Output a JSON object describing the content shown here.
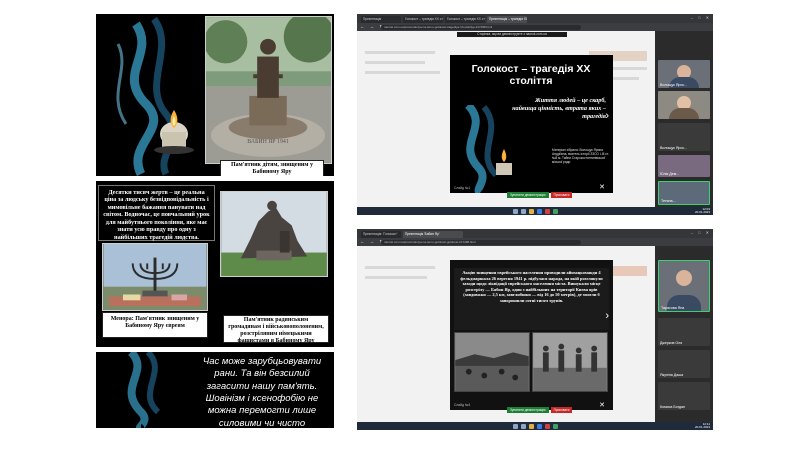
{
  "left_column": {
    "slide1": {
      "caption": "Пам'ятник дітям, знищеним у Бабиному Яру",
      "plinth_text": "ВАБИН ЯР 1941"
    },
    "slide2": {
      "text_block": "Десятки тисяч жертв – це реальна ціна за людську безвідповідальність і мимовільне бажання панувати над світом. Водночас, це повчальний урок для майбутнього покоління, яке має знати усю правду про одну з найбільших трагедій людства.",
      "menorah_caption": "Менора: Пам'ятник знищеним у Бабиному Яру євреям",
      "monument_caption": "Пам'ятник радянським громадянам і військовополоненим, розстріляним німецькими фашистами в Бабиному Яру"
    },
    "slide3": {
      "quote": "Час може зарубцьовувати рани. Та він безсилий загасити нашу пам'ять. Шовінізм і ксенофобію не можна перемогти лише силовими чи чисто політичними методами. Боротьба з цим злом проходить"
    }
  },
  "screenshot1": {
    "tabs": [
      "Презентація",
      "Голокост – трагедія ХХ столітт",
      "Голокост – трагедія ХХ ст",
      "Презентація – трагедія XX ст"
    ],
    "url": "naurok.com.ua/prezentaciya-na-temu-golokost-tragediya-hh-stolittya-217498.html",
    "share_bar": "Сторінка, яку ви демонструєте з naurok.com.ua",
    "slide_title": "Голокост – трагедія ХХ століття",
    "slide_subtitle": "Життя людей – це скарб, найвища цінність, втрата яких – трагедія",
    "author": "Матеріал зібрала: Волощук Ярина Андріївна, вчитель історії ЗЗСО І-ІІІ ст. №8 м. Тайпи Старокостянтинівської міської ради",
    "slide_number": "Слайд №1",
    "stop_button": "Зупинити демонстрацію",
    "hide_button": "Приховати",
    "participants": [
      {
        "name": "Волощук Ярос...",
        "video": true
      },
      {
        "name": "",
        "video": true
      },
      {
        "name": "Волощук Ярос...",
        "video": false
      },
      {
        "name": "Юлія Дем...",
        "video": true
      },
      {
        "name": "Тетяна...",
        "video": true
      }
    ],
    "clock_time": "12:03",
    "clock_date": "20.01.2023"
  },
  "screenshot2": {
    "tabs": [
      "Презентація: 'Голокост'",
      "Презентація 'Бабин Яр'"
    ],
    "url": "naurok.com.ua/prezentaciya-na-temu-golokost-golokost-217498.html",
    "text_block": "Акцію знищення єврейського населення проводили айнзацкоманди 4 фельдмаршала 26 вересня 1941 р. підбулася нарада, на якій розглянули заходи щодо ліквідації єврейського населення міста. Вишукали місце розстрілу — Бабин Яр, один з найбільших на території Києва ярів (завдовжки — 2,5 км, завглибшки — від 16 до 50 метрів), де змогли б запорошили сотні тисяч трупів.",
    "slide_number": "Слайд №4",
    "stop_button": "Зупинити демонстрацію",
    "hide_button": "Приховати",
    "participants": [
      {
        "name": "Тарасова Яна",
        "video": true
      },
      {
        "name": "Джерков Оля",
        "video": false
      },
      {
        "name": "Якуліна Даша",
        "video": false
      },
      {
        "name": "Комиса Богдан",
        "video": false
      }
    ],
    "clock_time": "12:11",
    "clock_date": "20.01.2023"
  }
}
